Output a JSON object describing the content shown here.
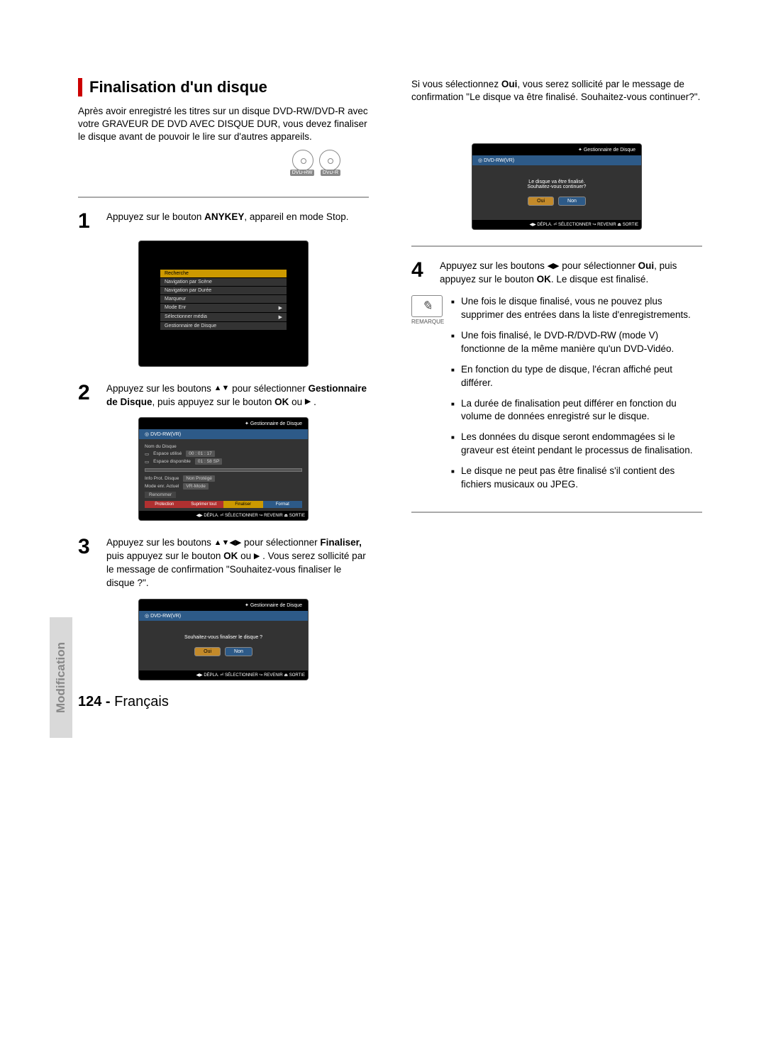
{
  "section": {
    "title": "Finalisation d'un disque"
  },
  "intro": "Après avoir enregistré les titres sur un disque DVD-RW/DVD-R avec votre GRAVEUR DE DVD AVEC DISQUE DUR, vous devez finaliser le disque avant de pouvoir le lire sur d'autres appareils.",
  "disc_labels": [
    "DVD-RW",
    "DVD-R"
  ],
  "steps": {
    "s1": {
      "num": "1",
      "pre": "Appuyez sur le bouton ",
      "bold": "ANYKEY",
      "post": ", appareil en mode Stop."
    },
    "s2": {
      "num": "2",
      "pre": "Appuyez sur les boutons ",
      "arrows": "▲▼",
      "mid": " pour sélectionner ",
      "bold": "Gestionnaire de Disque",
      "post": ", puis appuyez sur le bouton ",
      "bold2": "OK",
      "tail": " ou ",
      "arrow2": "▶",
      "end": " ."
    },
    "s3": {
      "num": "3",
      "pre": "Appuyez sur les boutons ",
      "arrows": "▲▼◀▶",
      "mid": " pour sélectionner ",
      "bold": "Finaliser,",
      "post": " puis appuyez sur le bouton ",
      "bold2": "OK",
      "tail": " ou ",
      "arrow2": "▶",
      "end": " . Vous serez sollicité par le message de confirmation \"Souhaitez-vous finaliser le disque ?\"."
    },
    "s4": {
      "num": "4",
      "pre": "Appuyez sur les boutons ",
      "arrows": "◀▶",
      "mid": " pour sélectionner ",
      "bold": "Oui",
      "post": ", puis appuyez sur le bouton ",
      "bold2": "OK",
      "end": ". Le disque est finalisé."
    }
  },
  "right_intro": {
    "pre": "Si vous sélectionnez ",
    "bold": "Oui",
    "post": ", vous serez sollicité par le message de confirmation \"Le disque va être finalisé. Souhaitez-vous continuer?\"."
  },
  "osd1_items": [
    "Recherche",
    "Navigation par Scène",
    "Navigation par Durée",
    "Marqueur",
    "Mode Enr",
    "Sélectionner média",
    "Gestionnaire de Disque"
  ],
  "osd2": {
    "header": "Gestionnaire de Disque",
    "titlebar_icon": "◎",
    "titlebar": "DVD-RW(VR)",
    "name_label": "Nom du Disque",
    "used_label": "Espace utilisé",
    "used_val": "00 : 01 : 17",
    "avail_label": "Espace disponible",
    "avail_val": "01 : 58 SP",
    "prot_label": "Info Prot. Disque",
    "prot_val": "Non Protégé",
    "mode_label": "Mode enr. Actuel",
    "mode_val": "VR-Mode",
    "rename": "Renommer",
    "tabs": [
      "Protection",
      "Suprimer tout",
      "Finaliser",
      "Format"
    ],
    "footer": "◀▶ DÉPLA.   ⏎ SÉLECTIONNER  ↪ REVENIR   ⏏ SORTIE"
  },
  "osd3": {
    "header": "Gestionnaire de Disque",
    "titlebar": "DVD-RW(VR)",
    "msg": "Souhaitez-vous finaliser le disque ?",
    "oui": "Oui",
    "non": "Non",
    "footer": "◀▶ DÉPLA.   ⏎ SÉLECTIONNER  ↪ REVENIR   ⏏ SORTIE"
  },
  "osd4": {
    "header": "Gestionnaire de Disque",
    "titlebar": "DVD-RW(VR)",
    "msg": "Le disque va être finalisé.\nSouhaitez-vous continuer?",
    "oui": "Oui",
    "non": "Non",
    "footer": "◀▶ DÉPLA.   ⏎ SÉLECTIONNER  ↪ REVENIR   ⏏ SORTIE"
  },
  "remark_label": "REMARQUE",
  "notes": [
    "Une fois le disque finalisé, vous ne pouvez plus supprimer des entrées dans la liste d'enregistrements.",
    "Une fois finalisé, le DVD-R/DVD-RW (mode V) fonctionne de la même manière qu'un DVD-Vidéo.",
    "En fonction du type de disque, l'écran affiché peut différer.",
    "La durée de finalisation peut différer en fonction du volume de données enregistré sur le disque.",
    "Les données du disque seront endommagées si le graveur est éteint pendant le processus de finalisation.",
    "Le disque ne peut pas être finalisé s'il contient des fichiers musicaux ou JPEG."
  ],
  "sidetab": "Modification",
  "page_footer": {
    "page": "124 -",
    "lang": "Français"
  }
}
